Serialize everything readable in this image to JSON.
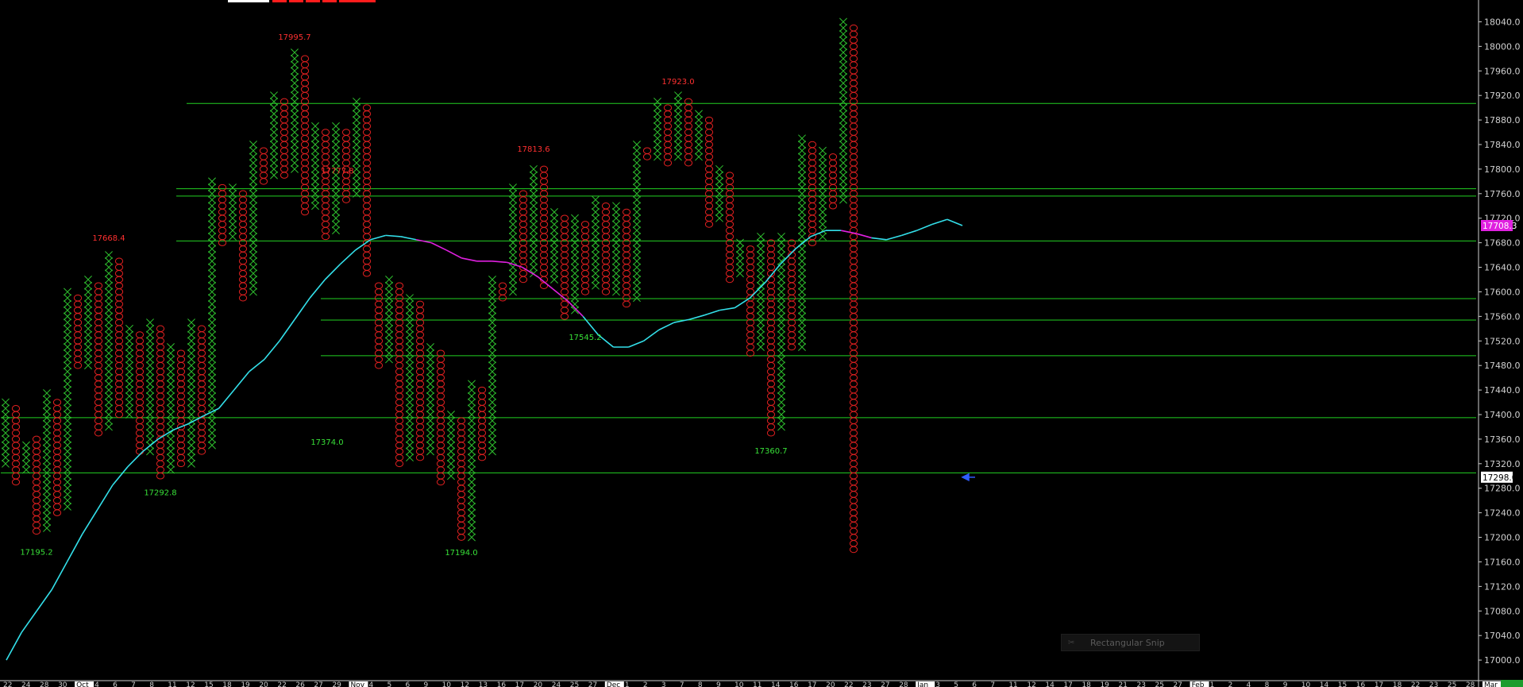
{
  "colors": {
    "background": "#000000",
    "x_box": "#2fc22f",
    "o_box": "#e02020",
    "peak_label": "#ff3030",
    "trough_label": "#38e038",
    "hline": "#22d022",
    "ma_up": "#33e0ea",
    "ma_down": "#e020e0",
    "axis_text": "#d0d0d0",
    "price_tag_current": "#e020e0",
    "arrow": "#2f5dff"
  },
  "ui": {
    "snip_tool": {
      "icon": "scissors-icon",
      "label": "Rectangular Snip"
    }
  },
  "chart_data": {
    "type": "point-and-figure",
    "ylim": [
      16960,
      18060
    ],
    "yticks": [
      17000,
      17040,
      17080,
      17120,
      17160,
      17200,
      17240,
      17280,
      17320,
      17360,
      17400,
      17440,
      17480,
      17520,
      17560,
      17600,
      17640,
      17680,
      17720,
      17760,
      17800,
      17840,
      17880,
      17920,
      17960,
      18000,
      18040
    ],
    "column_count": 46,
    "columns": [
      {
        "t": "X",
        "lo": 17320,
        "hi": 17420
      },
      {
        "t": "O",
        "lo": 17290,
        "hi": 17410
      },
      {
        "t": "X",
        "lo": 17310,
        "hi": 17350
      },
      {
        "t": "O",
        "lo": 17210,
        "hi": 17360
      },
      {
        "t": "X",
        "lo": 17215,
        "hi": 17430
      },
      {
        "t": "O",
        "lo": 17240,
        "hi": 17420
      },
      {
        "t": "X",
        "lo": 17250,
        "hi": 17600
      },
      {
        "t": "O",
        "lo": 17480,
        "hi": 17590
      },
      {
        "t": "X",
        "lo": 17480,
        "hi": 17620
      },
      {
        "t": "O",
        "lo": 17370,
        "hi": 17610
      },
      {
        "t": "X",
        "lo": 17380,
        "hi": 17660
      },
      {
        "t": "O",
        "lo": 17400,
        "hi": 17650
      },
      {
        "t": "X",
        "lo": 17400,
        "hi": 17540
      },
      {
        "t": "O",
        "lo": 17340,
        "hi": 17530
      },
      {
        "t": "X",
        "lo": 17340,
        "hi": 17550
      },
      {
        "t": "O",
        "lo": 17300,
        "hi": 17540
      },
      {
        "t": "X",
        "lo": 17310,
        "hi": 17510
      },
      {
        "t": "O",
        "lo": 17320,
        "hi": 17500
      },
      {
        "t": "X",
        "lo": 17320,
        "hi": 17550
      },
      {
        "t": "O",
        "lo": 17340,
        "hi": 17540
      },
      {
        "t": "X",
        "lo": 17350,
        "hi": 17780
      },
      {
        "t": "O",
        "lo": 17680,
        "hi": 17770
      },
      {
        "t": "X",
        "lo": 17690,
        "hi": 17770
      },
      {
        "t": "O",
        "lo": 17590,
        "hi": 17760
      },
      {
        "t": "X",
        "lo": 17600,
        "hi": 17840
      },
      {
        "t": "O",
        "lo": 17780,
        "hi": 17830
      },
      {
        "t": "X",
        "lo": 17790,
        "hi": 17920
      },
      {
        "t": "O",
        "lo": 17790,
        "hi": 17910
      },
      {
        "t": "X",
        "lo": 17800,
        "hi": 17990
      },
      {
        "t": "O",
        "lo": 17730,
        "hi": 17980
      },
      {
        "t": "X",
        "lo": 17740,
        "hi": 17870
      },
      {
        "t": "O",
        "lo": 17690,
        "hi": 17860
      },
      {
        "t": "X",
        "lo": 17700,
        "hi": 17870
      },
      {
        "t": "O",
        "lo": 17750,
        "hi": 17860
      },
      {
        "t": "X",
        "lo": 17760,
        "hi": 17910
      },
      {
        "t": "O",
        "lo": 17630,
        "hi": 17900
      },
      {
        "t": "X",
        "lo": 17640,
        "hi": 17700
      },
      {
        "t": "O",
        "lo": 17470,
        "hi": 17690
      },
      {
        "t": "X",
        "lo": 17480,
        "hi": 17740
      },
      {
        "t": "O",
        "lo": 17440,
        "hi": 17730
      },
      {
        "t": "X",
        "lo": 17440,
        "hi": 17600
      },
      {
        "t": "O",
        "lo": 17430,
        "hi": 17590
      },
      {
        "t": "X",
        "lo": 17440,
        "hi": 17590
      },
      {
        "t": "O",
        "lo": 17390,
        "hi": 17580
      },
      {
        "t": "X",
        "lo": 17380,
        "hi": 17760
      },
      {
        "t": "O",
        "lo": 17570,
        "hi": 17750
      }
    ],
    "columns_right": [
      {
        "t": "O",
        "lo": 17480,
        "hi": 17610
      },
      {
        "t": "X",
        "lo": 17490,
        "hi": 17620
      },
      {
        "t": "O",
        "lo": 17320,
        "hi": 17610
      },
      {
        "t": "X",
        "lo": 17330,
        "hi": 17590
      },
      {
        "t": "O",
        "lo": 17330,
        "hi": 17580
      },
      {
        "t": "X",
        "lo": 17340,
        "hi": 17510
      },
      {
        "t": "O",
        "lo": 17290,
        "hi": 17500
      },
      {
        "t": "X",
        "lo": 17300,
        "hi": 17400
      },
      {
        "t": "O",
        "lo": 17200,
        "hi": 17390
      },
      {
        "t": "X",
        "lo": 17200,
        "hi": 17450
      },
      {
        "t": "O",
        "lo": 17330,
        "hi": 17440
      },
      {
        "t": "X",
        "lo": 17340,
        "hi": 17620
      },
      {
        "t": "O",
        "lo": 17590,
        "hi": 17610
      },
      {
        "t": "X",
        "lo": 17600,
        "hi": 17770
      },
      {
        "t": "O",
        "lo": 17620,
        "hi": 17760
      },
      {
        "t": "X",
        "lo": 17630,
        "hi": 17800
      },
      {
        "t": "O",
        "lo": 17610,
        "hi": 17800
      },
      {
        "t": "X",
        "lo": 17620,
        "hi": 17730
      },
      {
        "t": "O",
        "lo": 17560,
        "hi": 17720
      },
      {
        "t": "X",
        "lo": 17570,
        "hi": 17720
      },
      {
        "t": "O",
        "lo": 17600,
        "hi": 17710
      },
      {
        "t": "X",
        "lo": 17610,
        "hi": 17750
      },
      {
        "t": "O",
        "lo": 17600,
        "hi": 17740
      },
      {
        "t": "X",
        "lo": 17600,
        "hi": 17740
      },
      {
        "t": "O",
        "lo": 17580,
        "hi": 17730
      },
      {
        "t": "X",
        "lo": 17590,
        "hi": 17840
      },
      {
        "t": "O",
        "lo": 17820,
        "hi": 17830
      },
      {
        "t": "X",
        "lo": 17820,
        "hi": 17910
      },
      {
        "t": "O",
        "lo": 17810,
        "hi": 17900
      },
      {
        "t": "X",
        "lo": 17820,
        "hi": 17920
      },
      {
        "t": "O",
        "lo": 17810,
        "hi": 17910
      },
      {
        "t": "X",
        "lo": 17820,
        "hi": 17890
      },
      {
        "t": "O",
        "lo": 17710,
        "hi": 17880
      },
      {
        "t": "X",
        "lo": 17720,
        "hi": 17800
      },
      {
        "t": "O",
        "lo": 17620,
        "hi": 17790
      },
      {
        "t": "X",
        "lo": 17630,
        "hi": 17680
      },
      {
        "t": "O",
        "lo": 17500,
        "hi": 17670
      },
      {
        "t": "X",
        "lo": 17510,
        "hi": 17690
      },
      {
        "t": "O",
        "lo": 17370,
        "hi": 17680
      },
      {
        "t": "X",
        "lo": 17380,
        "hi": 17690
      },
      {
        "t": "O",
        "lo": 17510,
        "hi": 17680
      },
      {
        "t": "X",
        "lo": 17510,
        "hi": 17850
      },
      {
        "t": "O",
        "lo": 17680,
        "hi": 17840
      },
      {
        "t": "X",
        "lo": 17690,
        "hi": 17830
      },
      {
        "t": "O",
        "lo": 17740,
        "hi": 17820
      },
      {
        "t": "X",
        "lo": 17750,
        "hi": 18040
      },
      {
        "t": "O",
        "lo": 17180,
        "hi": 18030
      }
    ],
    "annotations": [
      {
        "text": "17195.2",
        "kind": "trough",
        "col": 3,
        "value": 17195
      },
      {
        "text": "17668.4",
        "kind": "peak",
        "col": 10,
        "value": 17668
      },
      {
        "text": "17292.8",
        "kind": "trough",
        "col": 15,
        "value": 17292
      },
      {
        "text": "17995.7",
        "kind": "peak",
        "col": 28,
        "value": 17995
      },
      {
        "text": "17374.0",
        "kind": "trough",
        "rcol": -5,
        "value": 17374
      },
      {
        "text": "17777.8",
        "kind": "peak",
        "rcol": -4,
        "value": 17777
      },
      {
        "text": "17194.0",
        "kind": "trough",
        "rcol": 8,
        "value": 17194
      },
      {
        "text": "17813.6",
        "kind": "peak",
        "rcol": 15,
        "value": 17813
      },
      {
        "text": "17545.2",
        "kind": "trough",
        "rcol": 20,
        "value": 17545
      },
      {
        "text": "17923.0",
        "kind": "peak",
        "rcol": 29,
        "value": 17923
      },
      {
        "text": "17360.7",
        "kind": "trough",
        "rcol": 38,
        "value": 17360
      }
    ],
    "hlines": [
      {
        "value": 17907,
        "from_col": 18
      },
      {
        "value": 17768,
        "from_col": 17
      },
      {
        "value": 17756,
        "from_col": 17
      },
      {
        "value": 17683,
        "from_col": 17
      },
      {
        "value": 17589,
        "from_col": 31
      },
      {
        "value": 17554,
        "from_col": 31
      },
      {
        "value": 17496,
        "from_col": 31
      },
      {
        "value": 17395,
        "from_col": 0
      },
      {
        "value": 17305,
        "from_col": 0
      }
    ],
    "moving_average": [
      17000,
      17045,
      17080,
      17115,
      17160,
      17205,
      17245,
      17285,
      17315,
      17340,
      17360,
      17375,
      17385,
      17398,
      17410,
      17440,
      17470,
      17490,
      17520,
      17555,
      17590,
      17620,
      17645,
      17668,
      17685,
      17692,
      17690,
      17685,
      17680,
      17668,
      17655,
      17650,
      17650,
      17648,
      17640,
      17625,
      17605,
      17585,
      17560,
      17530,
      17510,
      17510,
      17520,
      17538,
      17550,
      17555,
      17562,
      17570,
      17574,
      17590,
      17615,
      17645,
      17670,
      17690,
      17700,
      17700,
      17695,
      17688,
      17685,
      17692,
      17700,
      17710,
      17718,
      17708
    ],
    "ma_down_segments": [
      [
        27,
        38
      ],
      [
        55,
        57
      ]
    ],
    "price_tags": [
      {
        "text": "17708.3",
        "value": 17708,
        "current": true
      },
      {
        "text": "17298.0",
        "value": 17298,
        "current": false
      }
    ],
    "x_ticks": [
      "22",
      "24",
      "28",
      "30",
      "Oct",
      "4",
      "6",
      "7",
      "8",
      "11",
      "12",
      "15",
      "18",
      "19",
      "20",
      "22",
      "26",
      "27",
      "29",
      "Nov",
      "4",
      "5",
      "6",
      "9",
      "10",
      "12",
      "13",
      "16",
      "17",
      "20",
      "24",
      "25",
      "27",
      "Dec",
      "1",
      "2",
      "3",
      "7",
      "8",
      "9",
      "10",
      "11",
      "14",
      "16",
      "17",
      "20",
      "22",
      "23",
      "27",
      "28",
      "Jan",
      "3",
      "5",
      "6",
      "7",
      "11",
      "12",
      "14",
      "17",
      "18",
      "19",
      "21",
      "23",
      "25",
      "27",
      "Feb",
      "1",
      "2",
      "4",
      "8",
      "9",
      "10",
      "14",
      "15",
      "16",
      "17",
      "18",
      "22",
      "23",
      "25",
      "28",
      "Mar"
    ]
  }
}
